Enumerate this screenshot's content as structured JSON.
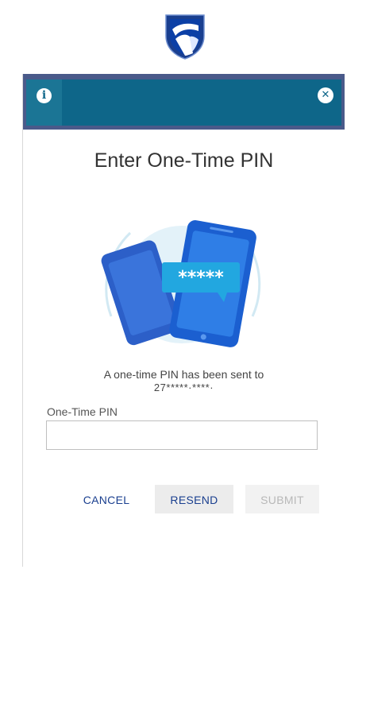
{
  "brand": {
    "logo_icon": "standard-bank-shield-logo",
    "color": "#0b3fa6"
  },
  "header": {
    "info_icon": "info-icon",
    "close_icon": "close-icon",
    "color": "#0e6689"
  },
  "dialog": {
    "title": "Enter One-Time PIN",
    "illustration": {
      "icon": "phones-otp-icon",
      "bubble_text": "*****"
    },
    "sent_message": "A one-time PIN has been sent to",
    "masked_number": "27*****·****·"
  },
  "form": {
    "pin_label": "One-Time PIN",
    "pin_value": "",
    "pin_placeholder": ""
  },
  "actions": {
    "cancel": "CANCEL",
    "resend": "RESEND",
    "submit": "SUBMIT"
  }
}
